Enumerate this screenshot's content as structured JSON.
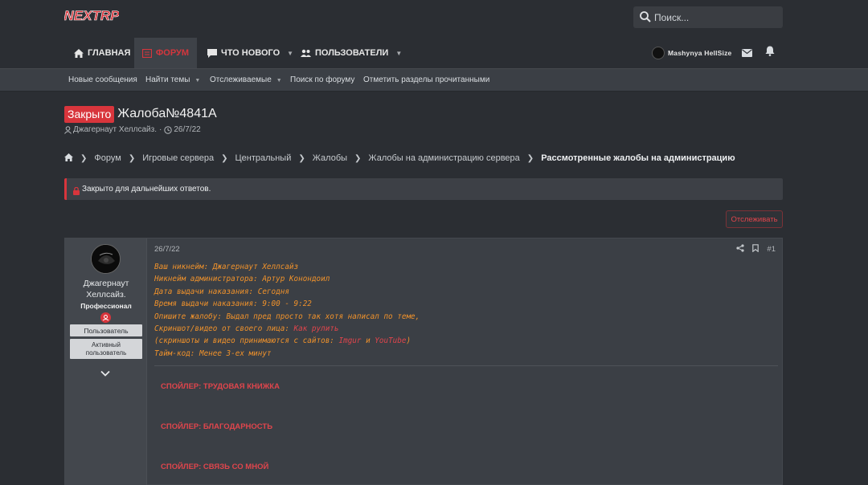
{
  "header": {
    "logo_text": "NEXTRP",
    "search_placeholder": "Поиск..."
  },
  "nav": {
    "home": "Главная",
    "forum": "Форум",
    "whats_new": "Что нового",
    "users": "Пользователи",
    "username": "Mashynya HellSize"
  },
  "subnav": [
    "Новые сообщения",
    "Найти темы",
    "Отслеживаемые",
    "Поиск по форуму",
    "Отметить разделы прочитанными"
  ],
  "thread": {
    "status_badge": "Закрыто",
    "title": "Жалоба№4841А",
    "author": "Джагернаут Хеллсайз.",
    "date": "26/7/22"
  },
  "breadcrumb": [
    "Форум",
    "Игровые сервера",
    "Центральный",
    "Жалобы",
    "Жалобы на администрацию сервера",
    "Рассмотренные жалобы на администрацию"
  ],
  "notice": "Закрыто для дальнейших ответов.",
  "follow_button": "Отслеживать",
  "post": {
    "user_name_line1": "Джагернаут",
    "user_name_line2": "Хеллсайз.",
    "user_title": "Профессионал",
    "banner1": "Пользователь",
    "banner2_line1": "Активный",
    "banner2_line2": "пользователь",
    "date": "26/7/22",
    "number": "#1",
    "lines": {
      "l1": "Ваш никнейм: Джагернаут Хеллсайз",
      "l2": "Никнейм администратора: Артур Конондоил",
      "l3": "Дата выдачи наказания: Сегодня",
      "l4": "Время выдачи наказания: 9:00 - 9:22",
      "l5": "Опишите жалобу: Выдал пред просто так хотя написал по теме,",
      "l6a": "Скриншот/видео от своего лица: ",
      "l6b": "Как рулить",
      "l7a": "(скриншоты и видео принимаются с сайтов: ",
      "l7b": "Imgur",
      "l7c": " и ",
      "l7d": "YouTube",
      "l7e": ")",
      "l8": "Тайм-код: Менее 3-ех минут"
    },
    "spoilers": [
      "СПОЙЛЕР: ТРУДОВАЯ КНИЖКА",
      "СПОЙЛЕР: БЛАГОДАРНОСТЬ",
      "СПОЙЛЕР: СВЯЗЬ СО МНОЙ"
    ]
  },
  "colors": {
    "accent_red": "#d8353c",
    "quote_orange": "#f0922b",
    "background": "#2b2e33"
  }
}
